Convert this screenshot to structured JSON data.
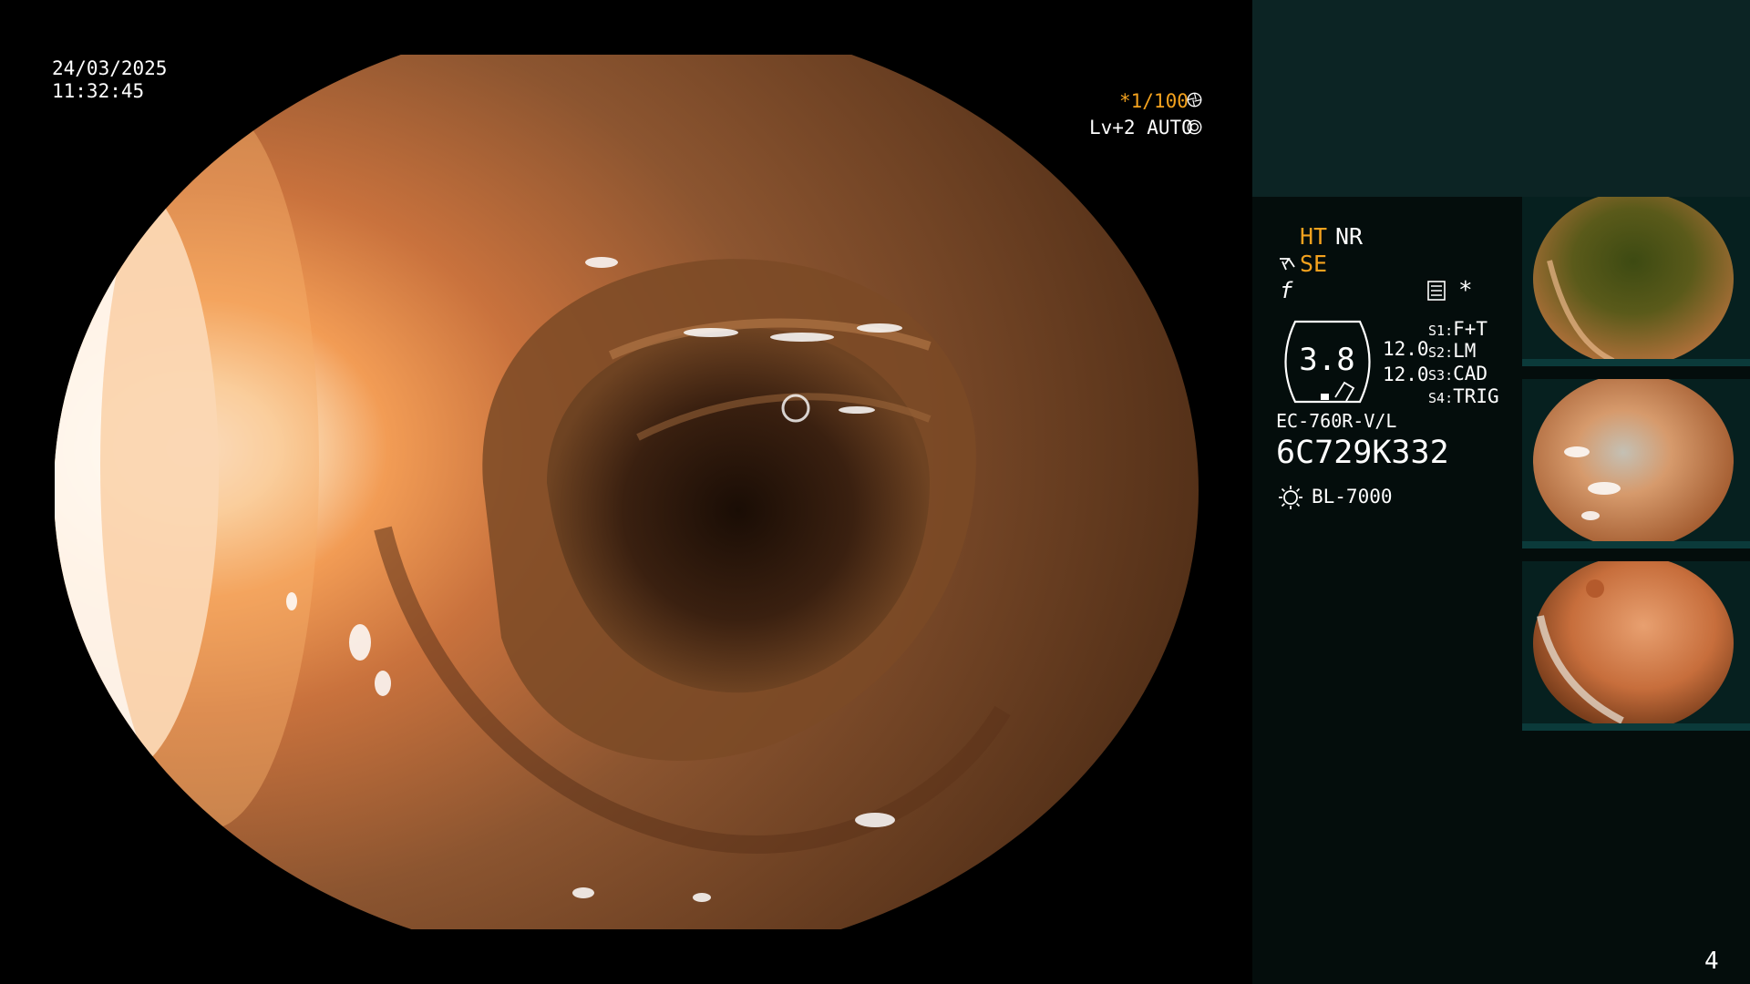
{
  "overlay": {
    "date": "24/03/2025",
    "time": "11:32:45",
    "shutter": "*1/100",
    "level": "Lv+2 AUTO"
  },
  "panel": {
    "ht": "HT",
    "nr": "NR",
    "se": "SE",
    "f_symbol": "f",
    "star": "*",
    "gauge_value": "3.8",
    "value_1": "12.0",
    "value_2": "12.0",
    "switches": [
      {
        "key": "S1",
        "value": "F+T"
      },
      {
        "key": "S2",
        "value": "LM"
      },
      {
        "key": "S3",
        "value": "CAD"
      },
      {
        "key": "S4",
        "value": "TRIG"
      }
    ],
    "model": "EC-760R-V/L",
    "serial": "6C729K332",
    "light_source": "BL-7000"
  },
  "page_number": "4",
  "icons": {
    "shutter": "aperture-icon",
    "auto": "auto-mode-icon",
    "se": "scope-se-icon",
    "record": "record-settings-icon",
    "light": "light-source-icon"
  },
  "colors": {
    "accent": "#f4a21e",
    "panel_bg": "#040d0c",
    "panel_top": "#0c2424",
    "text": "#ffffff"
  }
}
